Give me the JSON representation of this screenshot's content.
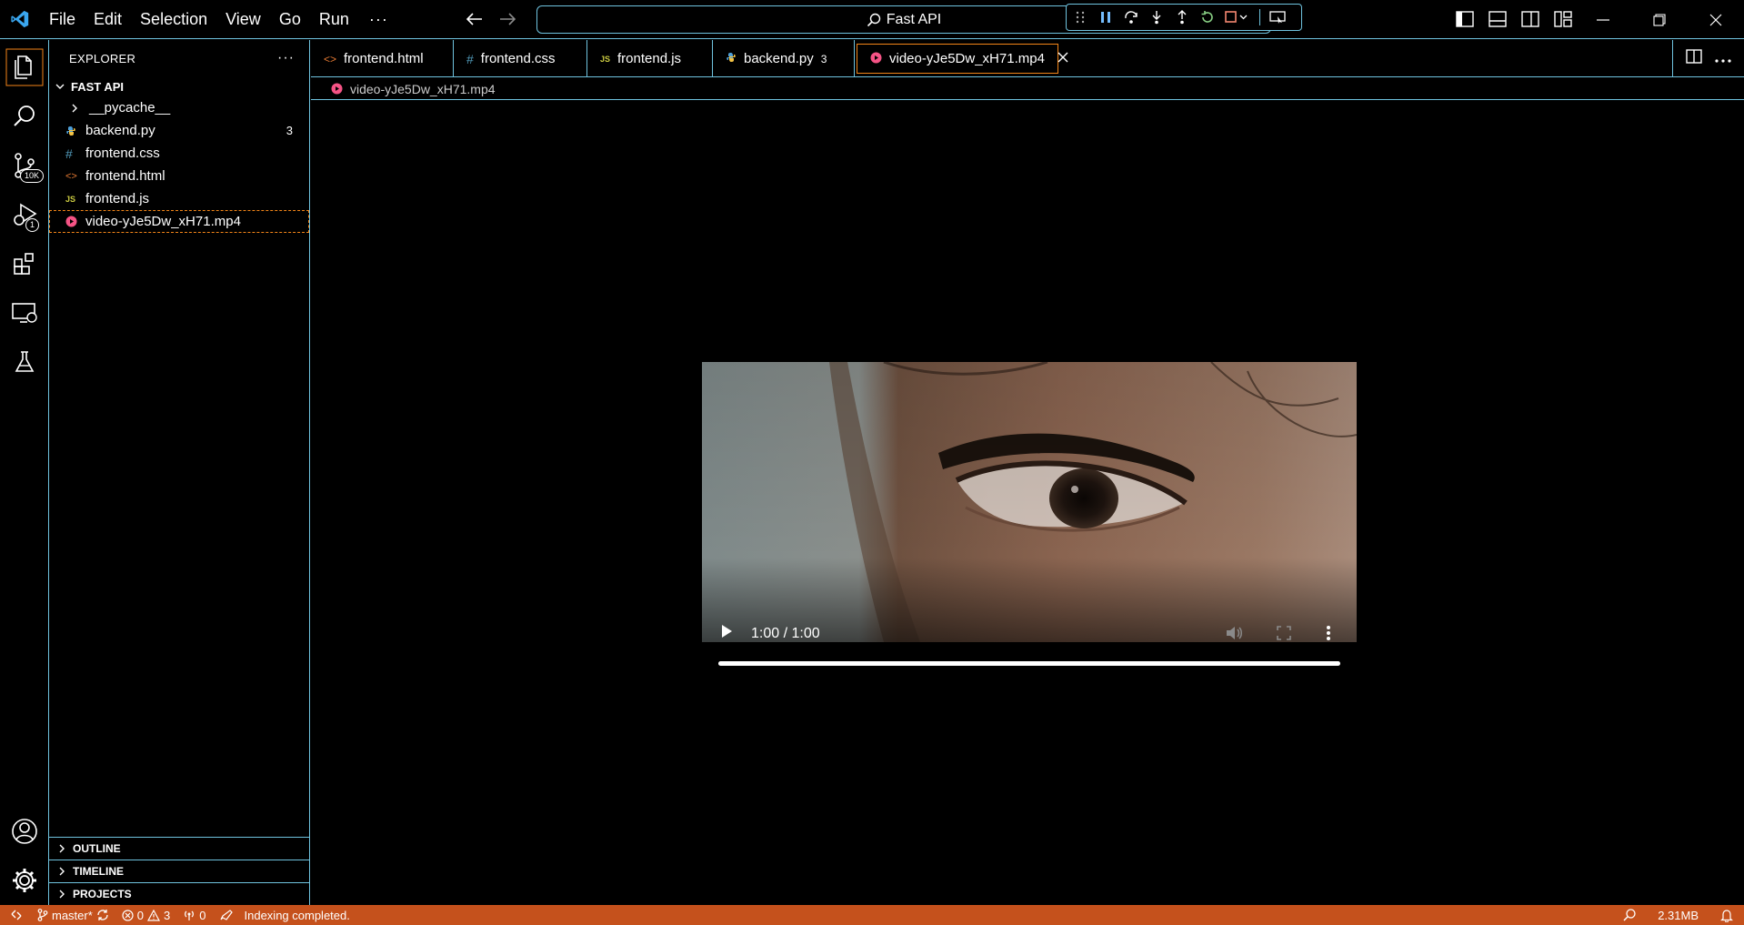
{
  "titlebar": {
    "menu": [
      "File",
      "Edit",
      "Selection",
      "View",
      "Go",
      "Run"
    ],
    "more": "···",
    "search_label": "Fast API"
  },
  "activitybar": {
    "scm_badge": "10K",
    "debug_badge": "1"
  },
  "explorer": {
    "title": "EXPLORER",
    "more": "···",
    "folder": "FAST API",
    "items": [
      {
        "label": "__pycache__",
        "icon": "chevron-right",
        "badge": ""
      },
      {
        "label": "backend.py",
        "icon": "python",
        "badge": "3"
      },
      {
        "label": "frontend.css",
        "icon": "#",
        "badge": ""
      },
      {
        "label": "frontend.html",
        "icon": "<>",
        "badge": ""
      },
      {
        "label": "frontend.js",
        "icon": "JS",
        "badge": ""
      },
      {
        "label": "video-yJe5Dw_xH71.mp4",
        "icon": "video",
        "badge": ""
      }
    ],
    "sections": [
      "OUTLINE",
      "TIMELINE",
      "PROJECTS"
    ]
  },
  "tabs": [
    {
      "label": "frontend.html",
      "icon": "<>",
      "badge": ""
    },
    {
      "label": "frontend.css",
      "icon": "#",
      "badge": ""
    },
    {
      "label": "frontend.js",
      "icon": "JS",
      "badge": ""
    },
    {
      "label": "backend.py",
      "icon": "python",
      "badge": "3"
    },
    {
      "label": "video-yJe5Dw_xH71.mp4",
      "icon": "video",
      "badge": "",
      "active": true
    }
  ],
  "breadcrumb": "video-yJe5Dw_xH71.mp4",
  "video": {
    "time": "1:00 / 1:00",
    "progress": 1.0
  },
  "statusbar": {
    "branch": "master*",
    "errors": "0",
    "warnings": "3",
    "ports": "0",
    "message": "Indexing completed.",
    "memory": "2.31MB"
  },
  "colors": {
    "contrast_border": "#6fc3df",
    "active_border": "#f38518",
    "statusbar": "#c5511c"
  }
}
